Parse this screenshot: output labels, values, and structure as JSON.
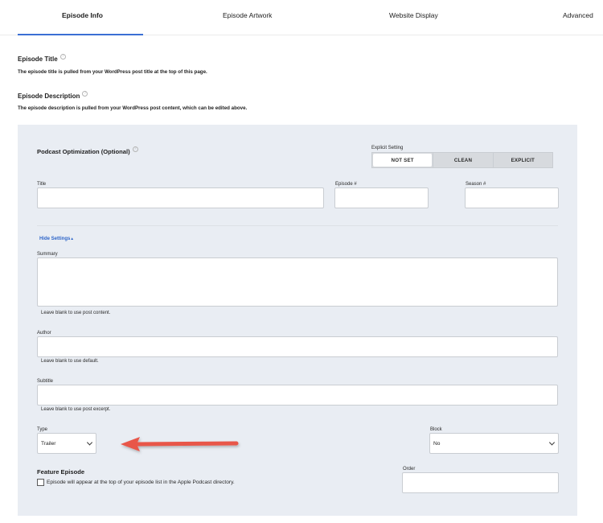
{
  "tabs": [
    {
      "label": "Episode Info",
      "active": true
    },
    {
      "label": "Episode Artwork",
      "active": false
    },
    {
      "label": "Website Display",
      "active": false
    },
    {
      "label": "Advanced",
      "active": false
    }
  ],
  "episode_title": {
    "label": "Episode Title",
    "note": "The episode title is pulled from your WordPress post title at the top of this page."
  },
  "episode_description": {
    "label": "Episode Description",
    "note": "The episode description is pulled from your WordPress post content, which can be edited above."
  },
  "optimization": {
    "title": "Podcast Optimization (Optional)",
    "explicit": {
      "label": "Explicit Setting",
      "options": [
        "NOT SET",
        "CLEAN",
        "EXPLICIT"
      ],
      "selected": "NOT SET"
    },
    "title_field": {
      "label": "Title",
      "value": ""
    },
    "episode_number": {
      "label": "Episode #",
      "value": ""
    },
    "season_number": {
      "label": "Season #",
      "value": ""
    },
    "hide_settings": "Hide Settings",
    "summary": {
      "label": "Summary",
      "value": "",
      "help": "Leave blank to use post content."
    },
    "author": {
      "label": "Author",
      "value": "",
      "help": "Leave blank to use default."
    },
    "subtitle": {
      "label": "Subtitle",
      "value": "",
      "help": "Leave blank to use post excerpt."
    },
    "type": {
      "label": "Type",
      "value": "Trailer"
    },
    "block": {
      "label": "Block",
      "value": "No"
    },
    "feature": {
      "title": "Feature Episode",
      "checkbox_label": "Episode will appear at the top of your episode list in the Apple Podcast directory.",
      "checked": false
    },
    "order": {
      "label": "Order",
      "value": ""
    }
  },
  "colors": {
    "accent": "#3b6fd4",
    "link": "#2f66c9",
    "panel_bg": "#e9edf3",
    "annotation_arrow": "#e8564a"
  },
  "icons": {
    "help": "help-circle-icon",
    "select_caret": "chevron-down-icon",
    "annotation": "red-arrow-icon"
  }
}
